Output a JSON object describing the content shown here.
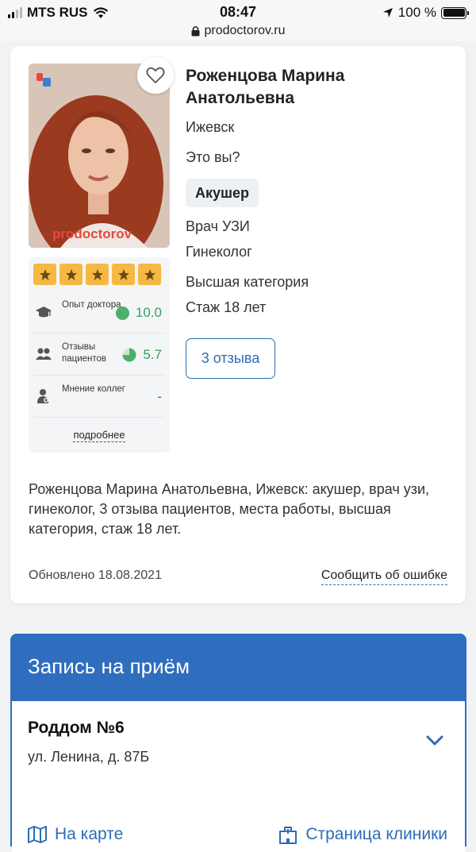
{
  "status_bar": {
    "carrier": "MTS RUS",
    "time": "08:47",
    "battery": "100 %",
    "battery_level": 1.0
  },
  "browser": {
    "url": "prodoctorov.ru"
  },
  "doctor": {
    "name": "Роженцова Марина Анатольевна",
    "city": "Ижевск",
    "is_it_you": "Это вы?",
    "specialty_badge": "Акушер",
    "specialties": [
      "Врач УЗИ",
      "Гинеколог"
    ],
    "category": "Высшая категория",
    "experience": "Стаж 18 лет",
    "reviews_button": "3 отзыва",
    "photo_watermark": "prodoctorov"
  },
  "rating": {
    "stars": 5,
    "metrics": [
      {
        "label": "Опыт доктора",
        "value": "10.0",
        "icon": "graduation-cap-icon"
      },
      {
        "label": "Отзывы пациентов",
        "value": "5.7",
        "icon": "people-icon"
      },
      {
        "label": "Мнение коллег",
        "value": "-",
        "icon": "doctor-icon"
      }
    ],
    "more_link": "подробнее"
  },
  "description": "Роженцова Марина Анатольевна, Ижевск: акушер, врач узи, гинеколог, 3 отзыва пациентов, места работы, высшая категория, стаж 18 лет.",
  "footer": {
    "updated": "Обновлено 18.08.2021",
    "report_error": "Сообщить об ошибке"
  },
  "appointment": {
    "title": "Запись на приём",
    "clinic_name": "Роддом №6",
    "clinic_address": "ул. Ленина, д. 87Б",
    "map_link": "На карте",
    "clinic_page_link": "Страница клиники"
  },
  "colors": {
    "accent": "#2f6dbf",
    "link": "#2d6cb5",
    "star": "#f5b843",
    "score": "#3a9d5d"
  }
}
